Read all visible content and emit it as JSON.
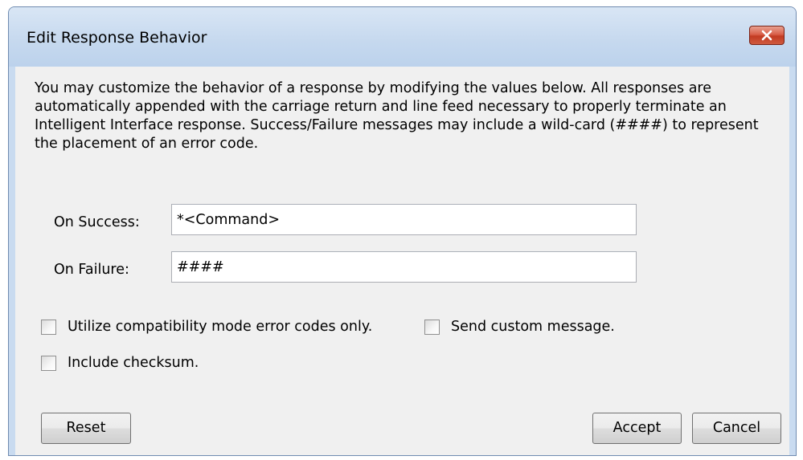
{
  "window": {
    "title": "Edit Response Behavior"
  },
  "description": "You may customize the behavior of a response by modifying the values below. All responses are automatically appended with the carriage return and line feed necessary to properly terminate an Intelligent Interface response. Success/Failure messages may include a wild-card (####) to represent the placement of an error code.",
  "fields": {
    "on_success": {
      "label": "On Success:",
      "value": "*<Command>"
    },
    "on_failure": {
      "label": "On Failure:",
      "value": "####"
    }
  },
  "checkboxes": {
    "compatibility": {
      "label": "Utilize compatibility mode error codes only.",
      "checked": false
    },
    "custom_message": {
      "label": "Send custom message.",
      "checked": false
    },
    "checksum": {
      "label": "Include checksum.",
      "checked": false
    }
  },
  "buttons": {
    "reset": "Reset",
    "accept": "Accept",
    "cancel": "Cancel"
  },
  "icons": {
    "close": "close-icon"
  },
  "colors": {
    "title_bar": "#c9dbf0",
    "close_button": "#c23b22",
    "dialog_background": "#f0f0f0"
  }
}
